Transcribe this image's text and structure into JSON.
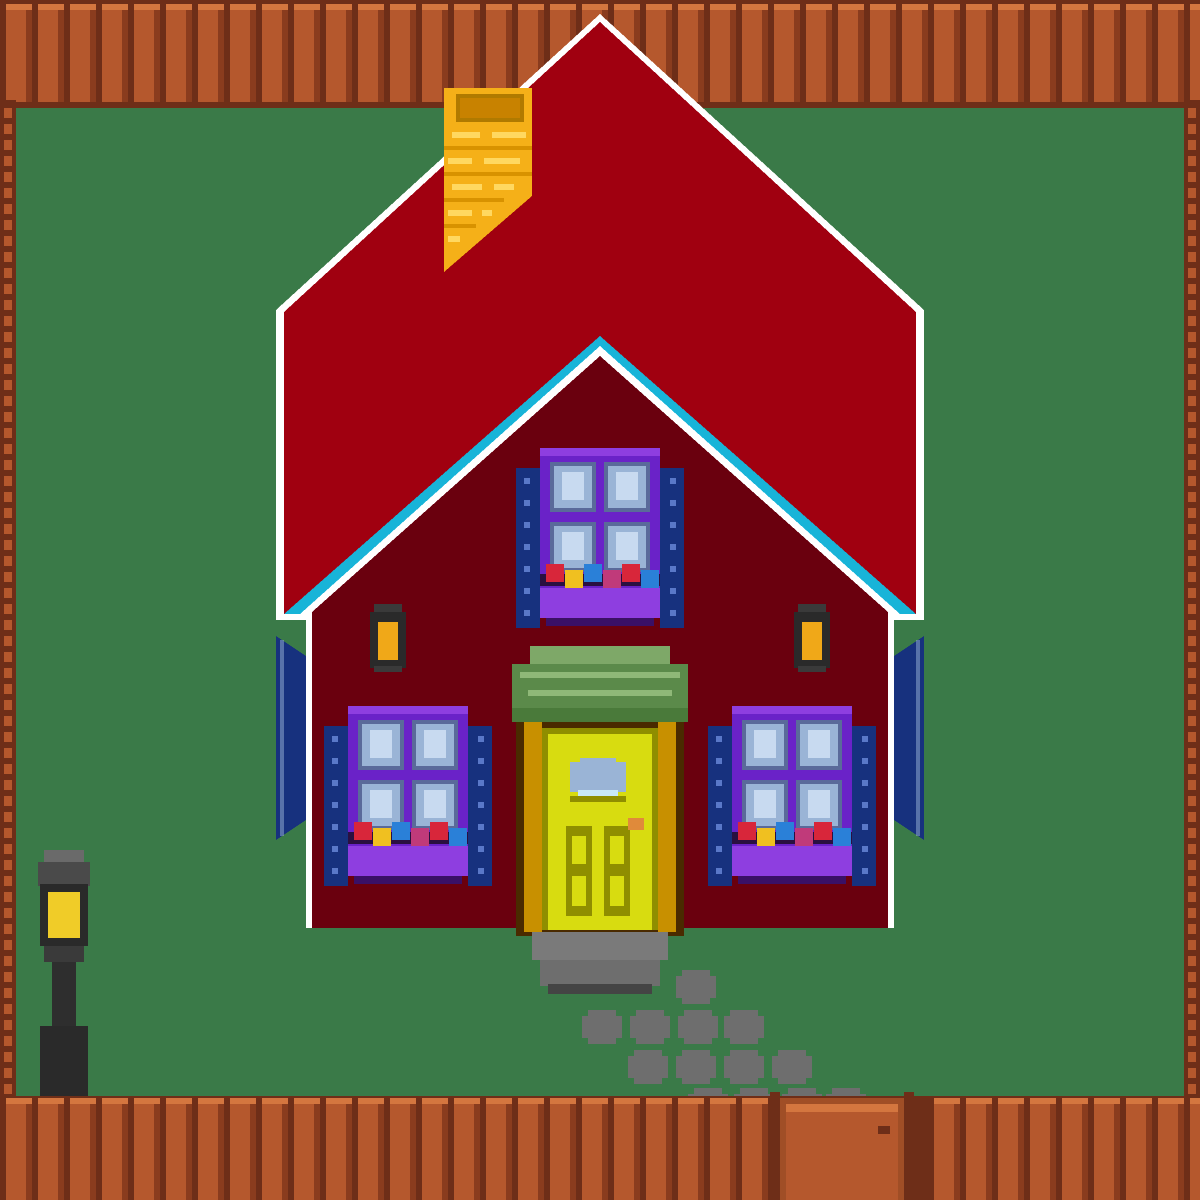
{
  "scene": {
    "kind": "pixel-art farmhouse yard",
    "objects": [
      "fence",
      "house",
      "chimney",
      "roof",
      "windows",
      "flower-boxes",
      "wall-lanterns",
      "front-door",
      "door-awning",
      "doorstep",
      "stepping-stones",
      "street-lamp",
      "yard-gate"
    ]
  },
  "colors": {
    "grass": "#3a7a48",
    "fence_light": "#b5582d",
    "fence_dark": "#6e2e18",
    "fence_highlight": "#d4763f",
    "roof": "#a00010",
    "roof_outline": "#ffffff",
    "wall": "#6a000e",
    "trim_cyan": "#18b4d8",
    "chimney": "#f5b018",
    "chimney_dark": "#c88200",
    "window_frame": "#6a22c8",
    "window_frame_light": "#8e3ee0",
    "window_glass": "#9ab4d6",
    "shutter": "#17317e",
    "door": "#d8dc10",
    "door_dark": "#8f8e00",
    "door_frame": "#c89000",
    "awning": "#5b8a4a",
    "awning_light": "#7ea868",
    "stone": "#6e6e6e",
    "lamp_post": "#2e2e2e",
    "lamp_light": "#f0cc28"
  },
  "icons": [
    "fence-icon",
    "house-icon",
    "chimney-icon",
    "door-icon",
    "window-icon",
    "lantern-icon",
    "lamp-icon",
    "gate-icon",
    "flower-icon",
    "stone-icon"
  ]
}
